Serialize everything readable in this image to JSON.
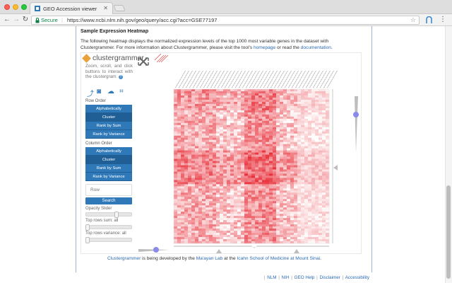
{
  "browser": {
    "tab_title": "GEO Accession viewer",
    "secure_label": "Secure",
    "url": "https://www.ncbi.nlm.nih.gov/geo/query/acc.cgi?acc=GSE77197"
  },
  "section": {
    "title": "Sample Expression Heatmap",
    "desc_text": "The following heatmap displays the normalized expression levels of the top 1000 most variable genes in the dataset with Clustergrammer. For more information about Clustergrammer, please visit the tool's ",
    "desc_link_homepage": "homepage",
    "desc_or": " or read the ",
    "desc_link_docs": "documentation",
    "desc_end": "."
  },
  "clustergrammer": {
    "logo_text": "clustergrammer",
    "help_text": "Zoom, scroll, and click buttons to interact with the clustergram.",
    "row_order_label": "Row Order",
    "row_buttons": [
      "Alphabetically",
      "Cluster",
      "Rank by Sum",
      "Rank by Variance"
    ],
    "column_order_label": "Column Order",
    "column_buttons": [
      "Alphabetically",
      "Cluster",
      "Rank by Sum",
      "Rank by Variance"
    ],
    "row_search_placeholder": "Row",
    "search_button": "Search",
    "opacity_slider_label": "Opacity Slider",
    "top_rows_sum_label": "Top rows sum: all",
    "top_rows_variance_label": "Top rows variance: all",
    "active_row_order": "Cluster",
    "active_column_order": "Cluster"
  },
  "credit": {
    "prefix": "Clustergrammer",
    "mid1": " is being developed by the ",
    "lab": "Ma'ayan Lab",
    "mid2": " at the ",
    "school": "Icahn School of Medicine at Mount Sinai",
    "end": "."
  },
  "footer": {
    "links": [
      "NLM",
      "NIH",
      "GEO Help",
      "Disclaimer",
      "Accessibility"
    ]
  },
  "colors": {
    "accent_blue": "#2f79b8",
    "heatmap_red": "#e8303a",
    "link_blue": "#2a6ab5",
    "secure_green": "#0b8043"
  }
}
